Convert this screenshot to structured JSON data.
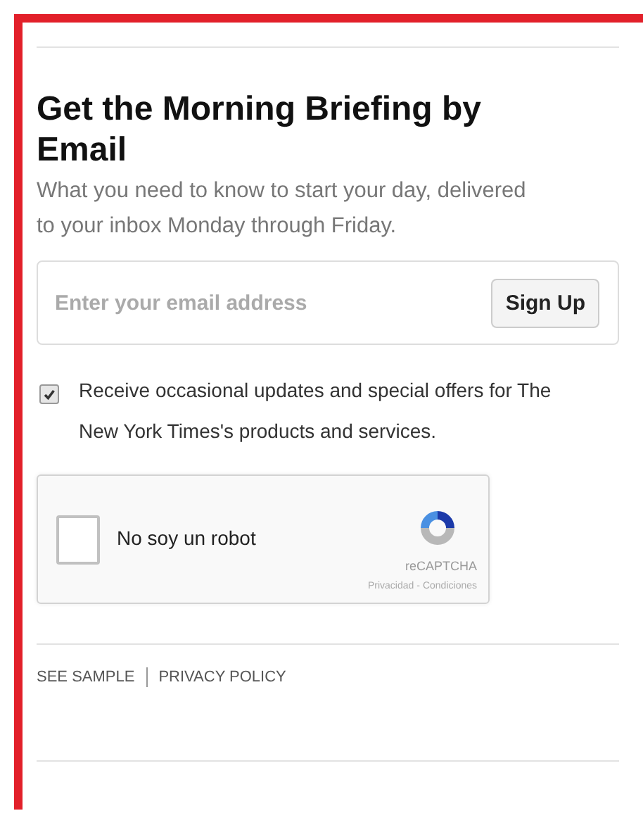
{
  "title": "Get the Morning Briefing by Email",
  "description": "What you need to know to start your day, delivered to your inbox Monday through Friday.",
  "email_field": {
    "placeholder": "Enter your email address"
  },
  "submit_button": "Sign Up",
  "opt_in": {
    "label": "Receive occasional updates and special offers for The New York Times's products and services.",
    "checked": true
  },
  "captcha": {
    "label": "No soy un robot",
    "checked": false,
    "brand": "reCAPTCHA",
    "privacy": "Privacidad",
    "separator": "-",
    "terms": "Condiciones"
  },
  "footer_links": [
    "SEE SAMPLE",
    "PRIVACY POLICY"
  ]
}
